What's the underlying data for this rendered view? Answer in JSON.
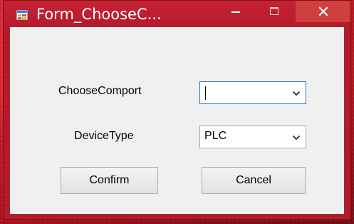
{
  "window": {
    "title": "Form_ChooseC...",
    "icon": "form-app-icon",
    "controls": {
      "minimize_icon": "minimize-icon",
      "maximize_icon": "maximize-icon",
      "close_icon": "close-icon"
    }
  },
  "form": {
    "comport": {
      "label": "ChooseComport",
      "value": ""
    },
    "device_type": {
      "label": "DeviceType",
      "value": "PLC"
    },
    "buttons": {
      "confirm": "Confirm",
      "cancel": "Cancel"
    }
  },
  "colors": {
    "titlebar": "#b71a2b",
    "close_button": "#cf3f3f",
    "client_bg": "#f0f0f0",
    "focus_border": "#2f74c9"
  }
}
